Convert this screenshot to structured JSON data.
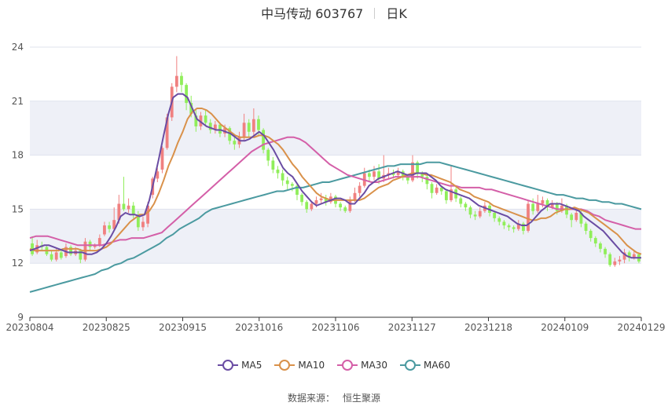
{
  "title": {
    "stock": "中马传动 603767",
    "period": "日K"
  },
  "source": {
    "label": "数据来源：",
    "value": "恒生聚源"
  },
  "legend": [
    {
      "name": "MA5",
      "color": "#6a4ca3"
    },
    {
      "name": "MA10",
      "color": "#d9914a"
    },
    {
      "name": "MA30",
      "color": "#d45fa8"
    },
    {
      "name": "MA60",
      "color": "#4b9aa0"
    }
  ],
  "colors": {
    "up": "#f08080",
    "down": "#90ee5a",
    "band": "#eef0f7",
    "grid": "#dfe3ee",
    "axis": "#555555"
  },
  "chart_data": {
    "type": "candlestick",
    "ylim": [
      9,
      24
    ],
    "y_ticks": [
      9,
      12,
      15,
      18,
      21,
      24
    ],
    "x_ticks": [
      "20230804",
      "20230825",
      "20230915",
      "20231016",
      "20231106",
      "20231127",
      "20231218",
      "20240109",
      "20240129"
    ],
    "ma_series": {
      "MA5": [
        12.7,
        12.8,
        12.9,
        13.0,
        13.0,
        12.9,
        12.8,
        12.7,
        12.6,
        12.6,
        12.6,
        12.6,
        12.5,
        12.5,
        12.6,
        12.8,
        13.1,
        13.5,
        14.0,
        14.6,
        14.8,
        14.7,
        14.7,
        14.6,
        14.7,
        15.5,
        16.6,
        17.8,
        19.1,
        20.3,
        21.2,
        21.4,
        21.4,
        21.2,
        20.6,
        20.0,
        19.8,
        19.6,
        19.5,
        19.4,
        19.4,
        19.3,
        19.2,
        19.0,
        18.8,
        18.8,
        18.9,
        19.1,
        19.3,
        19.1,
        18.7,
        18.3,
        17.8,
        17.3,
        17.0,
        16.8,
        16.4,
        16.0,
        15.7,
        15.4,
        15.2,
        15.3,
        15.4,
        15.5,
        15.6,
        15.6,
        15.5,
        15.3,
        15.3,
        15.6,
        15.9,
        16.3,
        16.5,
        16.7,
        16.8,
        16.9,
        17.0,
        17.1,
        17.0,
        16.9,
        16.9,
        17.0,
        17.0,
        17.0,
        16.8,
        16.6,
        16.3,
        16.1,
        16.0,
        15.9,
        15.8,
        15.7,
        15.6,
        15.4,
        15.2,
        15.1,
        15.0,
        14.9,
        14.8,
        14.7,
        14.6,
        14.4,
        14.2,
        14.1,
        14.1,
        14.3,
        14.6,
        14.9,
        15.1,
        15.3,
        15.3,
        15.3,
        15.2,
        15.1,
        15.0,
        14.9,
        14.6,
        14.4,
        14.2,
        14.0,
        13.8,
        13.5,
        13.2,
        12.9,
        12.6,
        12.4,
        12.3,
        12.3,
        12.3
      ],
      "MA10": [
        12.8,
        12.7,
        12.7,
        12.7,
        12.7,
        12.7,
        12.7,
        12.8,
        12.8,
        12.8,
        12.8,
        12.7,
        12.7,
        12.7,
        12.7,
        12.8,
        12.9,
        13.1,
        13.4,
        13.7,
        14.0,
        14.3,
        14.5,
        14.7,
        14.7,
        14.9,
        15.3,
        15.9,
        16.6,
        17.4,
        18.0,
        18.7,
        19.3,
        20.0,
        20.4,
        20.6,
        20.6,
        20.5,
        20.3,
        20.0,
        19.7,
        19.5,
        19.3,
        19.1,
        19.0,
        19.0,
        19.0,
        19.0,
        19.1,
        19.1,
        19.0,
        18.8,
        18.6,
        18.3,
        17.9,
        17.5,
        17.2,
        16.8,
        16.5,
        16.2,
        15.9,
        15.7,
        15.6,
        15.5,
        15.5,
        15.5,
        15.5,
        15.5,
        15.5,
        15.5,
        15.6,
        15.8,
        16.0,
        16.2,
        16.3,
        16.4,
        16.6,
        16.7,
        16.8,
        16.9,
        17.0,
        17.0,
        17.0,
        16.9,
        16.9,
        16.8,
        16.7,
        16.6,
        16.5,
        16.3,
        16.1,
        16.0,
        15.9,
        15.7,
        15.6,
        15.5,
        15.4,
        15.2,
        15.1,
        15.0,
        14.9,
        14.8,
        14.7,
        14.6,
        14.5,
        14.4,
        14.4,
        14.5,
        14.5,
        14.6,
        14.8,
        14.9,
        15.0,
        15.0,
        15.1,
        15.0,
        14.9,
        14.8,
        14.6,
        14.4,
        14.2,
        14.0,
        13.8,
        13.6,
        13.3,
        13.0,
        12.8,
        12.6,
        12.5
      ],
      "MA30": [
        13.4,
        13.5,
        13.5,
        13.5,
        13.4,
        13.3,
        13.2,
        13.1,
        13.0,
        13.0,
        13.0,
        13.0,
        13.0,
        13.1,
        13.2,
        13.3,
        13.3,
        13.4,
        13.4,
        13.4,
        13.5,
        13.6,
        13.7,
        14.0,
        14.3,
        14.6,
        14.9,
        15.2,
        15.5,
        15.8,
        16.1,
        16.4,
        16.7,
        17.0,
        17.3,
        17.6,
        17.9,
        18.2,
        18.4,
        18.6,
        18.7,
        18.8,
        18.9,
        19.0,
        19.0,
        18.9,
        18.7,
        18.4,
        18.1,
        17.8,
        17.5,
        17.3,
        17.1,
        16.9,
        16.8,
        16.7,
        16.6,
        16.5,
        16.5,
        16.6,
        16.7,
        16.8,
        16.8,
        16.8,
        16.8,
        16.8,
        16.7,
        16.6,
        16.5,
        16.4,
        16.3,
        16.3,
        16.2,
        16.2,
        16.2,
        16.2,
        16.1,
        16.1,
        16.0,
        15.9,
        15.8,
        15.7,
        15.6,
        15.5,
        15.4,
        15.3,
        15.2,
        15.1,
        15.0,
        15.0,
        15.0,
        15.0,
        15.0,
        14.9,
        14.7,
        14.6,
        14.4,
        14.3,
        14.2,
        14.1,
        14.0,
        13.9,
        13.9
      ],
      "MA60": [
        10.4,
        10.5,
        10.6,
        10.7,
        10.8,
        10.9,
        11.0,
        11.1,
        11.2,
        11.3,
        11.4,
        11.6,
        11.7,
        11.9,
        12.0,
        12.2,
        12.3,
        12.5,
        12.7,
        12.9,
        13.1,
        13.4,
        13.6,
        13.9,
        14.1,
        14.3,
        14.5,
        14.8,
        15.0,
        15.1,
        15.2,
        15.3,
        15.4,
        15.5,
        15.6,
        15.7,
        15.8,
        15.9,
        16.0,
        16.0,
        16.1,
        16.2,
        16.2,
        16.3,
        16.4,
        16.5,
        16.5,
        16.6,
        16.7,
        16.8,
        16.9,
        17.0,
        17.1,
        17.2,
        17.3,
        17.4,
        17.4,
        17.5,
        17.5,
        17.5,
        17.5,
        17.6,
        17.6,
        17.6,
        17.5,
        17.4,
        17.3,
        17.2,
        17.1,
        17.0,
        16.9,
        16.8,
        16.7,
        16.6,
        16.5,
        16.4,
        16.3,
        16.2,
        16.1,
        16.0,
        15.9,
        15.8,
        15.8,
        15.7,
        15.6,
        15.6,
        15.5,
        15.5,
        15.4,
        15.4,
        15.3,
        15.3,
        15.2,
        15.1,
        15.0
      ]
    },
    "candles": [
      [
        13.1,
        12.5,
        13.5,
        12.4
      ],
      [
        12.6,
        13.0,
        13.3,
        12.5
      ],
      [
        13.0,
        12.9,
        13.2,
        12.7
      ],
      [
        12.9,
        12.5,
        13.0,
        12.4
      ],
      [
        12.5,
        12.2,
        12.7,
        12.1
      ],
      [
        12.2,
        12.6,
        12.8,
        12.1
      ],
      [
        12.6,
        12.3,
        12.7,
        12.2
      ],
      [
        12.4,
        12.9,
        13.1,
        12.3
      ],
      [
        12.9,
        12.5,
        13.0,
        12.4
      ],
      [
        12.5,
        12.7,
        12.9,
        12.4
      ],
      [
        12.7,
        12.2,
        12.8,
        12.0
      ],
      [
        12.2,
        13.2,
        13.4,
        12.1
      ],
      [
        13.2,
        12.9,
        13.3,
        12.7
      ],
      [
        12.9,
        13.0,
        13.1,
        12.8
      ],
      [
        13.0,
        13.4,
        13.6,
        12.9
      ],
      [
        13.6,
        14.1,
        14.3,
        13.5
      ],
      [
        14.1,
        13.9,
        14.3,
        13.7
      ],
      [
        13.9,
        14.4,
        15.1,
        13.8
      ],
      [
        14.4,
        15.3,
        15.8,
        14.2
      ],
      [
        15.3,
        15.0,
        16.8,
        14.9
      ],
      [
        15.0,
        15.2,
        15.6,
        14.8
      ],
      [
        15.2,
        14.7,
        15.4,
        14.5
      ],
      [
        14.7,
        14.0,
        14.9,
        13.8
      ],
      [
        14.0,
        14.3,
        14.6,
        13.8
      ],
      [
        14.2,
        15.2,
        15.4,
        14.0
      ],
      [
        15.8,
        16.7,
        16.8,
        15.6
      ],
      [
        16.7,
        17.1,
        17.3,
        16.5
      ],
      [
        17.2,
        18.4,
        18.5,
        17.0
      ],
      [
        18.4,
        20.1,
        20.3,
        18.3
      ],
      [
        20.1,
        21.8,
        22.0,
        19.9
      ],
      [
        21.8,
        22.4,
        23.5,
        21.5
      ],
      [
        22.4,
        21.9,
        22.6,
        21.5
      ],
      [
        21.9,
        20.9,
        22.0,
        20.5
      ],
      [
        20.9,
        20.3,
        21.3,
        20.1
      ],
      [
        20.2,
        19.6,
        20.5,
        19.3
      ],
      [
        19.6,
        20.2,
        20.4,
        19.4
      ],
      [
        20.2,
        19.8,
        20.5,
        19.6
      ],
      [
        19.8,
        19.4,
        20.0,
        19.2
      ],
      [
        19.4,
        19.7,
        19.9,
        19.2
      ],
      [
        19.7,
        19.2,
        19.8,
        19.0
      ],
      [
        19.2,
        19.5,
        19.7,
        19.0
      ],
      [
        19.5,
        18.8,
        19.6,
        18.6
      ],
      [
        18.8,
        18.6,
        19.0,
        18.3
      ],
      [
        18.6,
        19.0,
        19.3,
        18.4
      ],
      [
        19.0,
        19.8,
        20.3,
        18.8
      ],
      [
        19.8,
        19.3,
        20.0,
        19.0
      ],
      [
        19.3,
        20.0,
        20.6,
        19.1
      ],
      [
        20.0,
        19.4,
        20.2,
        19.1
      ],
      [
        19.4,
        18.3,
        19.5,
        18.1
      ],
      [
        18.3,
        17.7,
        18.4,
        17.4
      ],
      [
        17.7,
        17.2,
        17.9,
        17.0
      ],
      [
        17.2,
        17.0,
        17.4,
        16.7
      ],
      [
        17.0,
        16.6,
        17.2,
        16.3
      ],
      [
        16.6,
        16.4,
        16.8,
        16.1
      ],
      [
        16.4,
        16.3,
        16.5,
        16.0
      ],
      [
        16.3,
        15.8,
        16.4,
        15.5
      ],
      [
        15.8,
        15.4,
        15.9,
        15.2
      ],
      [
        15.4,
        15.0,
        15.5,
        14.8
      ],
      [
        15.0,
        15.3,
        15.4,
        14.9
      ],
      [
        15.3,
        15.5,
        15.7,
        15.1
      ],
      [
        15.5,
        15.6,
        15.9,
        15.3
      ],
      [
        15.6,
        15.4,
        15.8,
        15.2
      ],
      [
        15.4,
        15.7,
        15.9,
        15.3
      ],
      [
        15.7,
        15.3,
        15.8,
        15.1
      ],
      [
        15.3,
        15.1,
        15.4,
        14.9
      ],
      [
        15.1,
        14.9,
        15.2,
        14.8
      ],
      [
        14.9,
        15.5,
        15.7,
        14.8
      ],
      [
        15.5,
        15.9,
        16.2,
        15.4
      ],
      [
        15.9,
        16.3,
        16.5,
        15.7
      ],
      [
        16.3,
        17.0,
        17.3,
        16.2
      ],
      [
        17.0,
        16.8,
        17.2,
        16.5
      ],
      [
        16.8,
        17.1,
        17.4,
        16.6
      ],
      [
        17.1,
        16.7,
        17.5,
        16.4
      ],
      [
        16.7,
        16.9,
        18.0,
        16.5
      ],
      [
        16.9,
        17.0,
        17.3,
        16.7
      ],
      [
        17.0,
        16.9,
        17.2,
        16.7
      ],
      [
        16.9,
        17.1,
        17.3,
        16.8
      ],
      [
        17.1,
        16.8,
        17.2,
        16.6
      ],
      [
        16.8,
        16.6,
        16.9,
        16.4
      ],
      [
        16.6,
        17.6,
        18.0,
        16.5
      ],
      [
        17.6,
        17.0,
        17.7,
        16.7
      ],
      [
        17.0,
        16.8,
        17.1,
        16.5
      ],
      [
        16.8,
        16.4,
        16.9,
        16.1
      ],
      [
        16.4,
        15.9,
        16.5,
        15.6
      ],
      [
        15.9,
        16.2,
        16.4,
        15.8
      ],
      [
        16.2,
        16.0,
        16.3,
        15.8
      ],
      [
        16.0,
        15.5,
        16.1,
        15.3
      ],
      [
        15.5,
        16.1,
        17.4,
        15.4
      ],
      [
        16.1,
        15.6,
        16.2,
        15.4
      ],
      [
        15.6,
        15.3,
        15.7,
        15.1
      ],
      [
        15.3,
        15.1,
        15.4,
        14.9
      ],
      [
        15.1,
        14.7,
        15.2,
        14.5
      ],
      [
        14.7,
        14.6,
        14.9,
        14.4
      ],
      [
        14.6,
        14.9,
        15.1,
        14.5
      ],
      [
        14.9,
        15.2,
        15.4,
        14.8
      ],
      [
        15.2,
        14.8,
        15.3,
        14.6
      ],
      [
        14.8,
        14.5,
        14.9,
        14.3
      ],
      [
        14.5,
        14.3,
        14.6,
        14.1
      ],
      [
        14.3,
        14.1,
        14.4,
        13.9
      ],
      [
        14.1,
        14.0,
        14.2,
        13.8
      ],
      [
        14.0,
        13.9,
        14.1,
        13.7
      ],
      [
        13.9,
        14.2,
        14.4,
        13.8
      ],
      [
        14.2,
        13.8,
        14.3,
        13.6
      ],
      [
        13.8,
        15.3,
        15.5,
        13.7
      ],
      [
        15.3,
        14.9,
        15.6,
        14.7
      ],
      [
        14.9,
        15.3,
        15.8,
        14.8
      ],
      [
        15.3,
        15.5,
        15.7,
        15.1
      ],
      [
        15.5,
        15.1,
        15.6,
        14.9
      ],
      [
        15.1,
        15.3,
        15.5,
        15.0
      ],
      [
        15.3,
        14.9,
        15.4,
        14.7
      ],
      [
        14.9,
        15.2,
        15.6,
        14.8
      ],
      [
        15.2,
        14.7,
        15.3,
        14.5
      ],
      [
        14.7,
        14.4,
        14.8,
        14.0
      ],
      [
        14.4,
        14.8,
        15.0,
        14.3
      ],
      [
        14.8,
        14.2,
        14.9,
        14.0
      ],
      [
        14.2,
        13.8,
        14.3,
        13.6
      ],
      [
        13.8,
        13.4,
        13.9,
        13.2
      ],
      [
        13.4,
        13.1,
        13.5,
        12.9
      ],
      [
        13.1,
        12.8,
        13.2,
        12.6
      ],
      [
        12.8,
        12.5,
        12.9,
        12.3
      ],
      [
        12.5,
        11.9,
        12.6,
        11.8
      ],
      [
        11.9,
        12.1,
        12.3,
        11.8
      ],
      [
        12.1,
        12.2,
        12.4,
        11.9
      ],
      [
        12.2,
        12.6,
        12.8,
        12.0
      ],
      [
        12.6,
        12.3,
        12.7,
        12.1
      ],
      [
        12.3,
        12.5,
        12.7,
        12.2
      ],
      [
        12.5,
        12.1,
        12.6,
        12.0
      ]
    ]
  }
}
